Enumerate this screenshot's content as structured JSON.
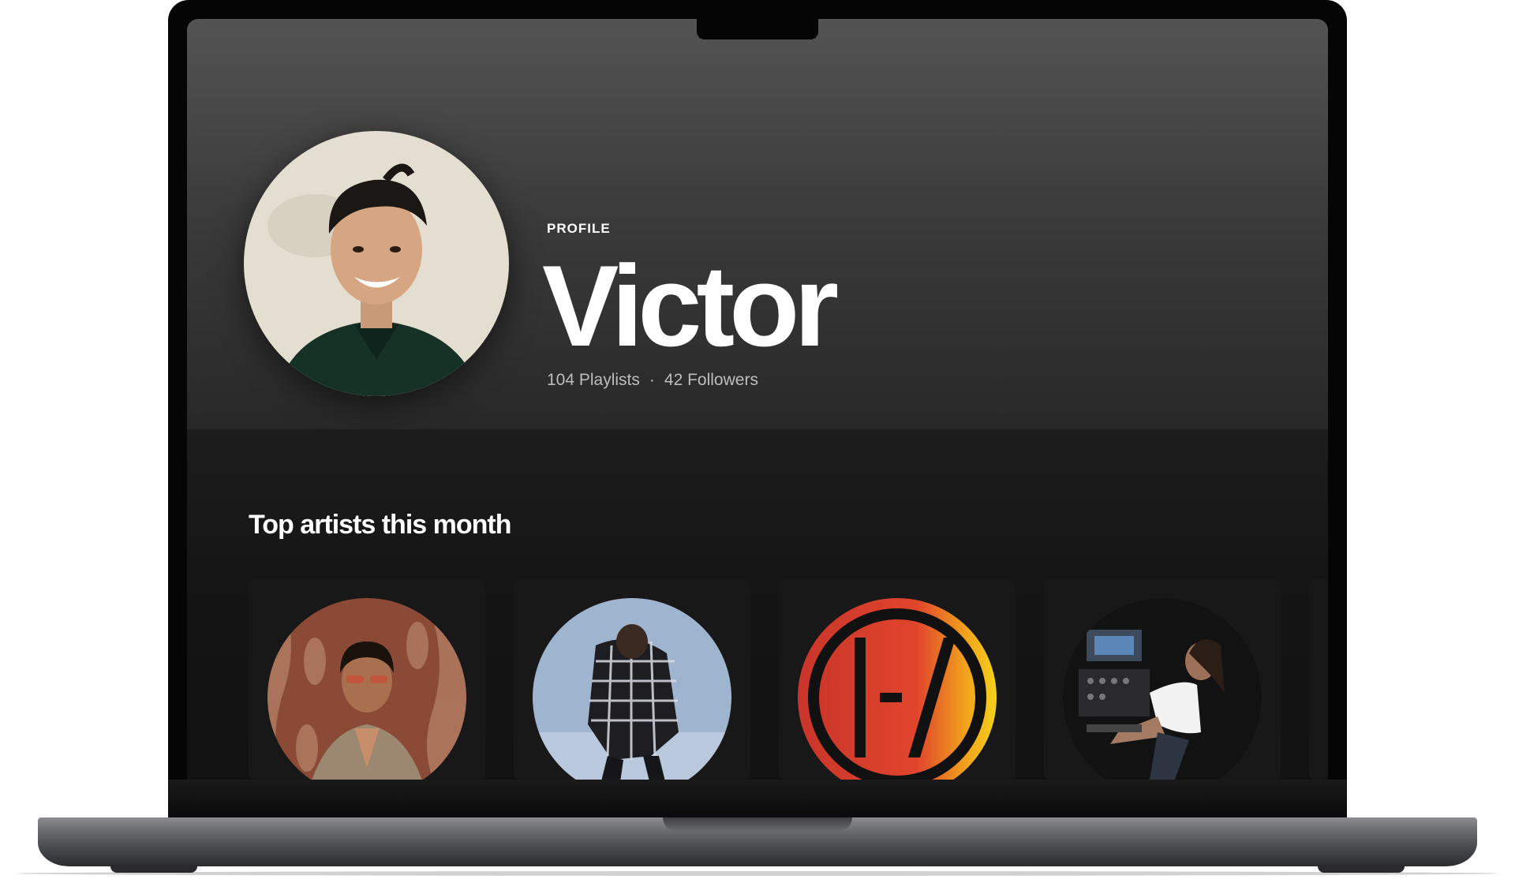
{
  "profile": {
    "label": "PROFILE",
    "name": "Victor",
    "playlists": "104 Playlists",
    "separator": "·",
    "followers": "42 Followers"
  },
  "top_artists": {
    "title": "Top artists this month",
    "artists": [
      {
        "image": "artist-photo-1"
      },
      {
        "image": "artist-photo-2"
      },
      {
        "image": "band-logo"
      },
      {
        "image": "artist-photo-4"
      }
    ]
  }
}
